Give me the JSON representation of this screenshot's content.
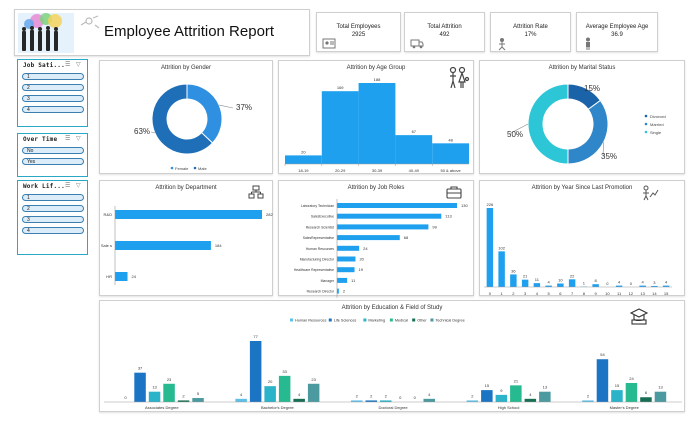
{
  "header": {
    "title": "Employee Attrition Report"
  },
  "kpis": [
    {
      "label": "Total Employees",
      "value": "2925",
      "icon": "id-card-icon"
    },
    {
      "label": "Total Attrition",
      "value": "492",
      "icon": "truck-icon"
    },
    {
      "label": "Attrition Rate",
      "value": "17%",
      "icon": "person-icon"
    },
    {
      "label": "Average Employee Age",
      "value": "36.9",
      "icon": "person-standing-icon"
    }
  ],
  "slicers": [
    {
      "title": "Job Sati...",
      "items": [
        "1",
        "2",
        "3",
        "4"
      ]
    },
    {
      "title": "Over Time",
      "items": [
        "No",
        "Yes"
      ]
    },
    {
      "title": "Work Lif...",
      "items": [
        "1",
        "2",
        "3",
        "4"
      ]
    }
  ],
  "chart_data": [
    {
      "id": "gender",
      "type": "pie",
      "title": "Attrition by Gender",
      "categories": [
        "Female",
        "Male"
      ],
      "values": [
        37,
        63
      ],
      "unit": "%",
      "labels": [
        "37%",
        "63%"
      ],
      "colors": [
        "#2f8fe0",
        "#1f6fb8"
      ],
      "legend": "bottom"
    },
    {
      "id": "age",
      "type": "bar",
      "title": "Attrition by Age Group",
      "categories": [
        "18-19",
        "20-29",
        "30-39",
        "40-49",
        "50 & above"
      ],
      "values": [
        20,
        169,
        188,
        67,
        48
      ],
      "color": "#1ea0ef"
    },
    {
      "id": "marital",
      "type": "pie",
      "title": "Attrition by Marital Status",
      "categories": [
        "Divorced",
        "Married",
        "Single"
      ],
      "values": [
        15,
        35,
        50
      ],
      "labels": [
        "15%",
        "35%",
        "50%"
      ],
      "colors": [
        "#1a63a8",
        "#2f86c8",
        "#2cc6d6"
      ],
      "legend": "right"
    },
    {
      "id": "department",
      "type": "bar",
      "orientation": "horizontal",
      "title": "Attrition by Department",
      "categories": [
        "R&D",
        "Sale s",
        "HR"
      ],
      "values": [
        282,
        184,
        24
      ],
      "color": "#1ea0ef"
    },
    {
      "id": "jobroles",
      "type": "bar",
      "orientation": "horizontal",
      "title": "Attrition by Job Roles",
      "categories": [
        "Laboratory Technician",
        "SalesExecutive",
        "Research Scientist",
        "SalesRepresentative",
        "Human Resources",
        "Manufacturing Director",
        "Healthcare Representative",
        "Manager",
        "Research Director"
      ],
      "values": [
        130,
        113,
        99,
        68,
        24,
        20,
        19,
        11,
        2
      ],
      "color": "#1ea0ef"
    },
    {
      "id": "promotion",
      "type": "bar",
      "title": "Attrition by Year Since Last Promotion",
      "categories": [
        "0",
        "1",
        "2",
        "3",
        "4",
        "5",
        "6",
        "7",
        "8",
        "9",
        "10",
        "11",
        "12",
        "13",
        "14",
        "15"
      ],
      "values": [
        226,
        102,
        36,
        21,
        11,
        4,
        10,
        22,
        1,
        8,
        0,
        4,
        0,
        4,
        3,
        4
      ],
      "color": "#1ea0ef"
    },
    {
      "id": "education",
      "type": "bar",
      "title": "Attrition by Education & Field of Study",
      "categories": [
        "Associates Degree",
        "Bachelor's Degree",
        "Doctoral Degree",
        "High School",
        "Master's Degree"
      ],
      "series": [
        {
          "name": "Human Resources",
          "values": [
            0,
            4,
            2,
            2,
            2
          ],
          "color": "#5ec0e8"
        },
        {
          "name": "Life Sciences",
          "values": [
            37,
            77,
            2,
            15,
            54
          ],
          "color": "#1c74c4"
        },
        {
          "name": "Marketing",
          "values": [
            13,
            20,
            2,
            9,
            15
          ],
          "color": "#2ab3c9"
        },
        {
          "name": "Medical",
          "values": [
            23,
            33,
            0,
            21,
            24
          ],
          "color": "#27b990"
        },
        {
          "name": "Other",
          "values": [
            2,
            4,
            0,
            4,
            6
          ],
          "color": "#176e54"
        },
        {
          "name": "Technical Degree",
          "values": [
            5,
            23,
            4,
            13,
            13
          ],
          "color": "#4a9aa0"
        }
      ],
      "legend": "top"
    }
  ]
}
